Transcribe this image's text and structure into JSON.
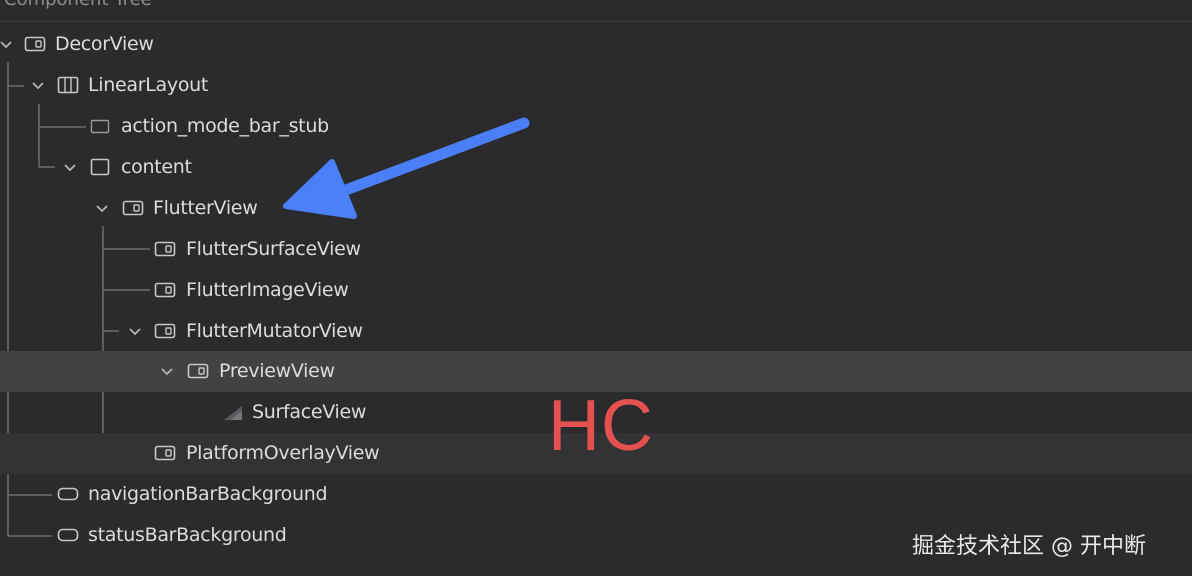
{
  "panel": {
    "title": "Component Tree"
  },
  "tree": {
    "nodes": [
      {
        "label": "DecorView",
        "icon": "view-icon",
        "expanded": true
      },
      {
        "label": "LinearLayout",
        "icon": "linear-layout-icon",
        "expanded": true
      },
      {
        "label": "action_mode_bar_stub",
        "icon": "view-stub-icon"
      },
      {
        "label": "content",
        "icon": "frame-layout-icon",
        "expanded": true
      },
      {
        "label": "FlutterView",
        "icon": "view-icon",
        "expanded": true
      },
      {
        "label": "FlutterSurfaceView",
        "icon": "view-icon"
      },
      {
        "label": "FlutterImageView",
        "icon": "view-icon"
      },
      {
        "label": "FlutterMutatorView",
        "icon": "view-icon",
        "expanded": true
      },
      {
        "label": "PreviewView",
        "icon": "view-icon",
        "expanded": true,
        "selected": true
      },
      {
        "label": "SurfaceView",
        "icon": "surface-view-icon"
      },
      {
        "label": "PlatformOverlayView",
        "icon": "view-icon"
      },
      {
        "label": "navigationBarBackground",
        "icon": "rounded-view-icon"
      },
      {
        "label": "statusBarBackground",
        "icon": "rounded-view-icon"
      }
    ]
  },
  "annotations": {
    "hc_text": "HC",
    "hc_color": "#e5514f",
    "arrow_color": "#4a7ff7"
  },
  "watermark": {
    "text": "掘金技术社区 @ 开中断"
  }
}
